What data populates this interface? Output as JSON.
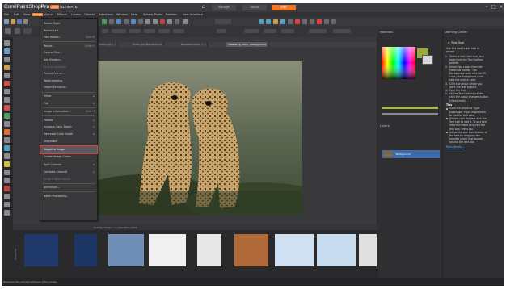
{
  "app": {
    "logo_text": "Corel",
    "product": "PaintShop",
    "pro": "Pro",
    "version": "2020",
    "edition": "ULTIMATE"
  },
  "workspace_tabs": [
    "Manage",
    "Adjust",
    "Edit"
  ],
  "menubar": [
    "File",
    "Edit",
    "View",
    "Image",
    "Adjust",
    "Effects",
    "Layers",
    "Objects",
    "Selections",
    "Window",
    "Help",
    "Sphera Photo",
    "Palettes",
    "User Interface"
  ],
  "image_menu": {
    "items": [
      {
        "label": "Rotate Right",
        "shortcut": "",
        "arrow": false,
        "disabled": false
      },
      {
        "label": "Rotate Left",
        "shortcut": "",
        "arrow": false,
        "disabled": false
      },
      {
        "label": "Free Rotate...",
        "shortcut": "Ctrl+R",
        "arrow": false,
        "disabled": false
      },
      {
        "sep": true
      },
      {
        "label": "Resize...",
        "shortcut": "Shift+S",
        "arrow": false,
        "disabled": false
      },
      {
        "label": "Canvas Size...",
        "shortcut": "",
        "arrow": false,
        "disabled": false
      },
      {
        "label": "Add Borders...",
        "shortcut": "",
        "arrow": false,
        "disabled": false
      },
      {
        "label": "Crop to Selection",
        "shortcut": "",
        "arrow": false,
        "disabled": true
      },
      {
        "label": "Picture Frame...",
        "shortcut": "",
        "arrow": false,
        "disabled": false
      },
      {
        "label": "Watermarking",
        "shortcut": "",
        "arrow": false,
        "disabled": false
      },
      {
        "label": "Object Extractor...",
        "shortcut": "",
        "arrow": false,
        "disabled": false
      },
      {
        "sep": true
      },
      {
        "label": "Mirror",
        "shortcut": "",
        "arrow": true,
        "disabled": false
      },
      {
        "label": "Flip",
        "shortcut": "",
        "arrow": true,
        "disabled": false
      },
      {
        "sep": true
      },
      {
        "label": "Image Information...",
        "shortcut": "Shift+I",
        "arrow": false,
        "disabled": false
      },
      {
        "sep": true
      },
      {
        "label": "Palette",
        "shortcut": "",
        "arrow": true,
        "disabled": false
      },
      {
        "label": "Increase Color Depth",
        "shortcut": "",
        "arrow": true,
        "disabled": false
      },
      {
        "label": "Decrease Color Depth",
        "shortcut": "",
        "arrow": true,
        "disabled": false
      },
      {
        "label": "Greyscale",
        "shortcut": "",
        "arrow": false,
        "disabled": false
      },
      {
        "sep": true
      },
      {
        "label": "Negative Image",
        "shortcut": "",
        "arrow": false,
        "disabled": false,
        "highlight": true
      },
      {
        "label": "Create Image Colors",
        "shortcut": "",
        "arrow": false,
        "disabled": false
      },
      {
        "sep": true
      },
      {
        "label": "Split Channel",
        "shortcut": "",
        "arrow": true,
        "disabled": false
      },
      {
        "label": "Combine Channel",
        "shortcut": "",
        "arrow": true,
        "disabled": false
      },
      {
        "label": "Undo in New Object",
        "shortcut": "",
        "arrow": false,
        "disabled": true
      },
      {
        "sep": true
      },
      {
        "label": "Animation...",
        "shortcut": "",
        "arrow": false,
        "disabled": false
      },
      {
        "sep": true
      },
      {
        "label": "Batch Processing...",
        "shortcut": "",
        "arrow": false,
        "disabled": false
      }
    ]
  },
  "doc_tabs": [
    "Photo..jpg (...)",
    "Photo..jpg (Background)",
    "Negative Image (...)",
    "cheetah @ 100% (Background)"
  ],
  "panels": {
    "materials_title": "Materials",
    "layers_title": "Layers",
    "layer_name": "Background",
    "learning_title": "Learning Center",
    "learning_section": "Text Tool",
    "learning_intro": [
      "Use this tool to add text to",
      "photos."
    ],
    "steps": [
      [
        "Select a font, font size, and",
        "style from the Tool Options",
        "palette."
      ],
      [
        "Select two colors from the",
        "Materials palette. The",
        "Background color sets the fill",
        "color, the Foreground color",
        "sets the outline color."
      ],
      [
        "Click the photo where you",
        "want the text to start."
      ],
      [
        "Type the text."
      ],
      [
        "On the Tool Options palette,",
        "click the Apply changes button",
        "(check mark)."
      ]
    ],
    "tips_title": "Tips",
    "tips": [
      [
        "Save the photo as \"type",
        "pspimage\" if you might want",
        "to edit the text later."
      ],
      [
        "Double-click the text with the",
        "Text tool to edit it. To add text",
        "insertion mode and view the",
        "text box, press Esc."
      ],
      [
        "Adjust the size and rotation of",
        "the text by dragging the",
        "handles (dots) that appear",
        "around the text box."
      ]
    ],
    "more_info": "More details..."
  },
  "organizer": {
    "label": "Organizer",
    "path": "Sort By: Folder  •  C:\\Users\\Pics 2020"
  },
  "status": "Reverses the colors/brightness of the image",
  "colors": {
    "accent": "#f07a2a",
    "menu_highlight_border": "#e04040",
    "fg_swatch": "#9aa840",
    "bg_swatch": "#d8d8d8"
  }
}
